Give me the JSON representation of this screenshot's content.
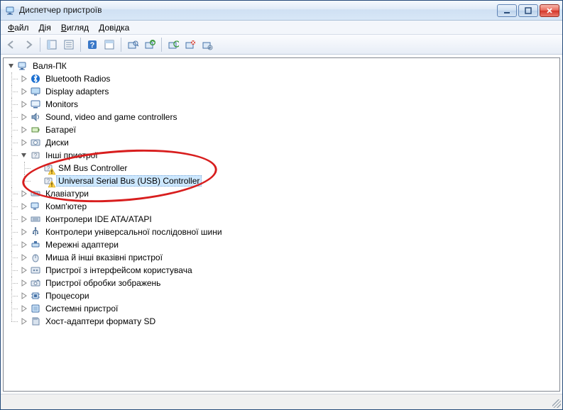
{
  "window": {
    "title": "Диспетчер пристроїв"
  },
  "menu": {
    "file": "Файл",
    "action": "Дія",
    "view": "Вигляд",
    "help": "Довідка",
    "hot": {
      "file": "Ф",
      "action": "Д",
      "view": "В",
      "help": "Д"
    }
  },
  "tree": {
    "root": "Валя-ПК",
    "items": [
      {
        "label": "Bluetooth Radios",
        "icon": "bluetooth"
      },
      {
        "label": "Display adapters",
        "icon": "display"
      },
      {
        "label": "Monitors",
        "icon": "monitor"
      },
      {
        "label": "Sound, video and game controllers",
        "icon": "sound"
      },
      {
        "label": "Батареї",
        "icon": "battery"
      },
      {
        "label": "Диски",
        "icon": "disk"
      },
      {
        "label": "Інші пристрої",
        "icon": "other",
        "expanded": true,
        "children": [
          {
            "label": "SM Bus Controller",
            "icon": "unknown",
            "warn": true
          },
          {
            "label": "Universal Serial Bus (USB) Controller",
            "icon": "unknown",
            "warn": true,
            "selected": true
          }
        ]
      },
      {
        "label": "Клавіатури",
        "icon": "keyboard"
      },
      {
        "label": "Комп'ютер",
        "icon": "computer-cat"
      },
      {
        "label": "Контролери IDE ATA/ATAPI",
        "icon": "ide"
      },
      {
        "label": "Контролери універсальної послідовної шини",
        "icon": "usb"
      },
      {
        "label": "Мережні адаптери",
        "icon": "network"
      },
      {
        "label": "Миша й інші вказівні пристрої",
        "icon": "mouse"
      },
      {
        "label": "Пристрої з інтерфейсом користувача",
        "icon": "hid"
      },
      {
        "label": "Пристрої обробки зображень",
        "icon": "imaging"
      },
      {
        "label": "Процесори",
        "icon": "cpu"
      },
      {
        "label": "Системні пристрої",
        "icon": "system"
      },
      {
        "label": "Хост-адаптери формату SD",
        "icon": "sd"
      }
    ]
  }
}
